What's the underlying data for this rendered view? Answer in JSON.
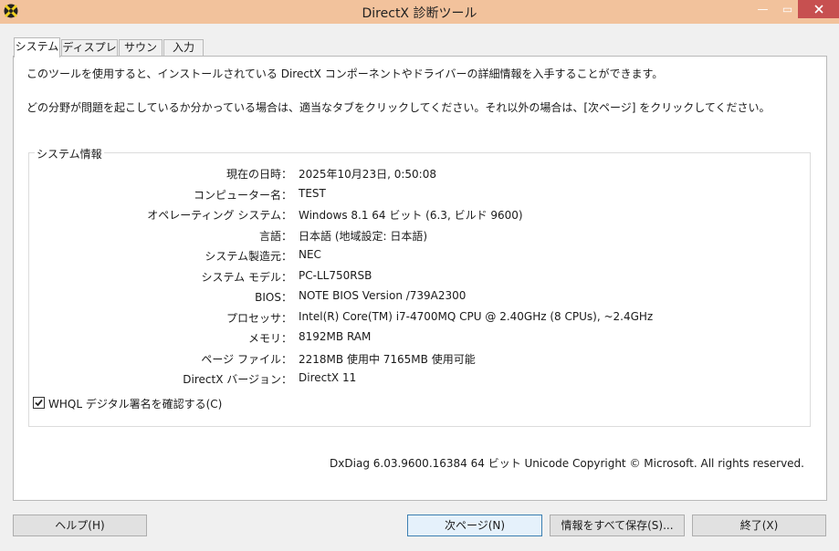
{
  "window": {
    "title": "DirectX 診断ツール",
    "icon": "directx-logo-icon",
    "minimize_glyph": "—",
    "maximize_glyph": "▭",
    "close_icon": "close-icon",
    "titlebar_color": "#f2c29c",
    "close_color": "#c75050"
  },
  "tabs": [
    {
      "label": "システム",
      "active": true
    },
    {
      "label": "ディスプレイ",
      "active": false
    },
    {
      "label": "サウンド",
      "active": false
    },
    {
      "label": "入力",
      "active": false
    }
  ],
  "intro": {
    "line1": "このツールを使用すると、インストールされている DirectX コンポーネントやドライバーの詳細情報を入手することができます。",
    "line2": "どの分野が問題を起こしているか分かっている場合は、適当なタブをクリックしてください。それ以外の場合は、[次ページ] をクリックしてください。"
  },
  "system_info": {
    "group_title": "システム情報",
    "rows": [
      {
        "label": "現在の日時：",
        "value": "2025年10月23日, 0:50:08"
      },
      {
        "label": "コンピューター名：",
        "value": "TEST"
      },
      {
        "label": "オペレーティング システム：",
        "value": "Windows 8.1 64 ビット (6.3, ビルド 9600)"
      },
      {
        "label": "言語：",
        "value": "日本語 (地域設定: 日本語)"
      },
      {
        "label": "システム製造元：",
        "value": "NEC"
      },
      {
        "label": "システム モデル：",
        "value": "PC-LL750RSB"
      },
      {
        "label": "BIOS：",
        "value": "NOTE BIOS Version /739A2300"
      },
      {
        "label": "プロセッサ：",
        "value": "Intel(R) Core(TM) i7-4700MQ CPU @ 2.40GHz (8 CPUs), ~2.4GHz"
      },
      {
        "label": "メモリ：",
        "value": "8192MB RAM"
      },
      {
        "label": "ページ ファイル：",
        "value": "2218MB 使用中 7165MB 使用可能"
      },
      {
        "label": "DirectX バージョン：",
        "value": "DirectX 11"
      }
    ]
  },
  "whql": {
    "label": "WHQL デジタル署名を確認する(C)",
    "checked": true
  },
  "footer": "DxDiag 6.03.9600.16384 64 ビット Unicode  Copyright © Microsoft. All rights reserved.",
  "buttons": {
    "help": "ヘルプ(H)",
    "next": "次ページ(N)",
    "save": "情報をすべて保存(S)...",
    "exit": "終了(X)"
  }
}
